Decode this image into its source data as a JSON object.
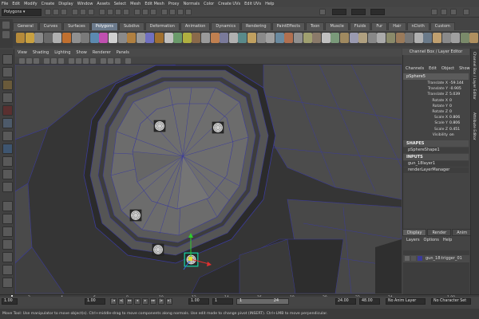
{
  "menubar": [
    "File",
    "Edit",
    "Modify",
    "Create",
    "Display",
    "Window",
    "Assets",
    "Select",
    "Mesh",
    "Edit Mesh",
    "Proxy",
    "Normals",
    "Color",
    "Create UVs",
    "Edit UVs",
    "Help"
  ],
  "status": {
    "mode": "Polygons"
  },
  "shelf": {
    "tabs": [
      "General",
      "Curves",
      "Surfaces",
      "Polygons",
      "Subdivs",
      "Deformation",
      "Animation",
      "Dynamics",
      "Rendering",
      "PaintEffects",
      "Toon",
      "Muscle",
      "Fluids",
      "Fur",
      "Hair",
      "nCloth",
      "Custom"
    ],
    "active_tab": "Polygons"
  },
  "panel": {
    "menu": [
      "View",
      "Shading",
      "Lighting",
      "Show",
      "Renderer",
      "Panels"
    ]
  },
  "channel_box": {
    "title": "Channel Box / Layer Editor",
    "menu": [
      "Channels",
      "Edit",
      "Object",
      "Show"
    ],
    "object": "pSphere5",
    "attributes": [
      {
        "label": "Translate X",
        "value": "-59.144"
      },
      {
        "label": "Translate Y",
        "value": "-0.905"
      },
      {
        "label": "Translate Z",
        "value": "5.039"
      },
      {
        "label": "Rotate X",
        "value": "0"
      },
      {
        "label": "Rotate Y",
        "value": "0"
      },
      {
        "label": "Rotate Z",
        "value": "0"
      },
      {
        "label": "Scale X",
        "value": "0.806"
      },
      {
        "label": "Scale Y",
        "value": "0.806"
      },
      {
        "label": "Scale Z",
        "value": "0.451"
      },
      {
        "label": "Visibility",
        "value": "on"
      }
    ],
    "shapes_header": "SHAPES",
    "shape": "pSphereShape1",
    "inputs_header": "INPUTS",
    "inputs": [
      "gun_18layer1",
      "renderLayerManager"
    ]
  },
  "layer_editor": {
    "tabs": [
      "Display",
      "Render",
      "Anim"
    ],
    "active_tab": "Display",
    "menu": [
      "Layers",
      "Options",
      "Help"
    ],
    "layers": [
      "gun_18:trigger_01"
    ]
  },
  "side_tabs": [
    "Channel Box / Layer Editor",
    "Attribute Editor"
  ],
  "timeline": {
    "ticks": [
      "1",
      "2",
      "4",
      "6",
      "8",
      "10",
      "12",
      "14",
      "16",
      "18",
      "20",
      "22",
      "24"
    ],
    "current_frame": "1.00"
  },
  "range": {
    "start_field": "1.00",
    "start": "1.00",
    "playback_start": "1.00",
    "slider_start": "1",
    "slider_end": "24",
    "end": "24.00",
    "end_field": "48.00",
    "anim_layer": "No Anim Layer",
    "char_set": "No Character Set"
  },
  "help_line": "Move Tool: Use manipulator to move object(s). Ctrl+middle-drag to move components along normals. Use edit mode to change pivot (INSERT). Ctrl+LMB to move perpendicular."
}
